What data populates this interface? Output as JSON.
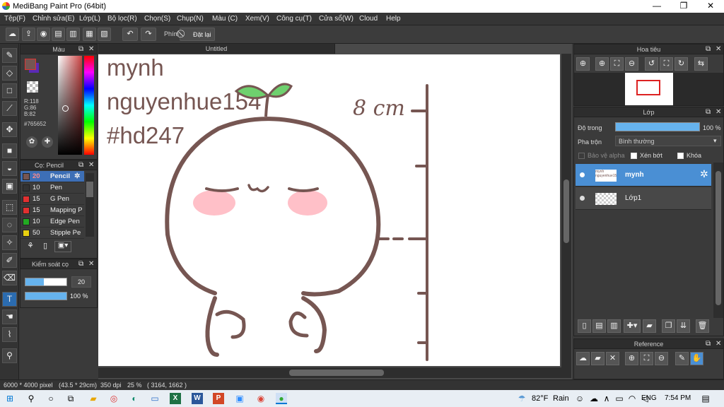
{
  "app": {
    "title": "MediBang Paint Pro (64bit)"
  },
  "window_controls": {
    "minimize": "—",
    "maximize": "❐",
    "close": "✕"
  },
  "menu": [
    "Tệp(F)",
    "Chỉnh sửa(E)",
    "Lớp(L)",
    "Bộ lọc(R)",
    "Chọn(S)",
    "Chụp(N)",
    "Màu (C)",
    "Xem(V)",
    "Công cụ(T)",
    "Cửa sổ(W)",
    "Cloud",
    "Help"
  ],
  "toolbar": {
    "key_label": "Phím",
    "cancel_label": "Đặt lại"
  },
  "color_panel": {
    "title": "Màu",
    "r": "R:118",
    "g": "G:86",
    "b": "B:82",
    "hex": "#765652",
    "main_color": "#765652",
    "sub_color": "#5a2bb5"
  },
  "brush_panel": {
    "title": "Cọ: Pencil",
    "items": [
      {
        "size": "20",
        "name": "Pencil",
        "color": "#765652"
      },
      {
        "size": "10",
        "name": "Pen",
        "color": "#333333"
      },
      {
        "size": "15",
        "name": "G Pen",
        "color": "#e03030"
      },
      {
        "size": "15",
        "name": "Mapping P",
        "color": "#e03030"
      },
      {
        "size": "10",
        "name": "Edge Pen",
        "color": "#22aa22"
      },
      {
        "size": "50",
        "name": "Stipple Pe",
        "color": "#e8d010"
      }
    ]
  },
  "brush_control": {
    "title": "Kiểm soát cọ",
    "size": "20",
    "opacity": "100 %",
    "size_level": 0.45,
    "opacity_level": 1.0
  },
  "canvas": {
    "tab": "Untitled"
  },
  "artwork": {
    "text1": "mynh",
    "text2": "nguyenhue154",
    "text3": "#hd247",
    "measure": "8 cm",
    "ink": "#765652",
    "blush": "#ffc0c8",
    "sprout": "#6ed06e"
  },
  "navigator": {
    "title": "Hoa tiêu"
  },
  "layer_panel": {
    "title": "Lớp",
    "opacity_label": "Độ trong",
    "opacity_value": "100 %",
    "opacity_level": 1.0,
    "blend_label": "Pha trộn",
    "blend_value": "Bình thường",
    "protect_alpha": "Bảo vệ alpha",
    "clipping": "Xén bớt",
    "lock": "Khóa",
    "layers": [
      {
        "name": "mynh",
        "thumb_text": "mynh nguyenhue154",
        "selected": true
      },
      {
        "name": "Lớp1",
        "thumb_text": "",
        "selected": false
      }
    ]
  },
  "reference": {
    "title": "Reference"
  },
  "status": {
    "size": "6000 * 4000 pixel",
    "cm": "(43.5 * 29cm)",
    "dpi": "350 dpi",
    "zoom": "25 %",
    "coords": "( 3164, 1662 )"
  },
  "taskbar": {
    "weather_temp": "82°F",
    "weather_text": "Rain",
    "lang": "ENG",
    "time": "7:54 PM"
  }
}
